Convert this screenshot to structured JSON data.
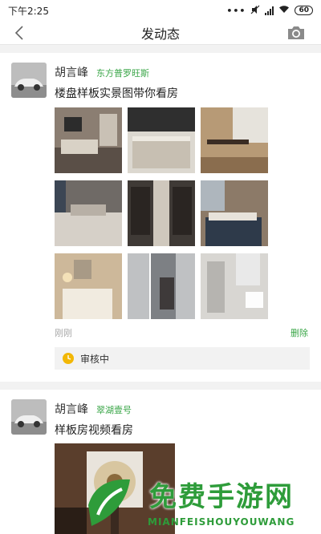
{
  "status_bar": {
    "time": "下午2:25",
    "battery": "60"
  },
  "nav": {
    "title": "发动态"
  },
  "posts": [
    {
      "author": "胡言峰",
      "location": "东方普罗旺斯",
      "text": "楼盘样板实景图带你看房",
      "time": "刚刚",
      "delete_label": "删除",
      "review_status": "审核中"
    },
    {
      "author": "胡言峰",
      "location": "翠湖壹号",
      "text": "样板房视频看房"
    }
  ],
  "watermark": {
    "title": "免费手游网",
    "subtitle": "MIANFEISHOUYOUWANG"
  },
  "colors": {
    "accent_green": "#3aa648",
    "review_clock": "#f2b705"
  }
}
